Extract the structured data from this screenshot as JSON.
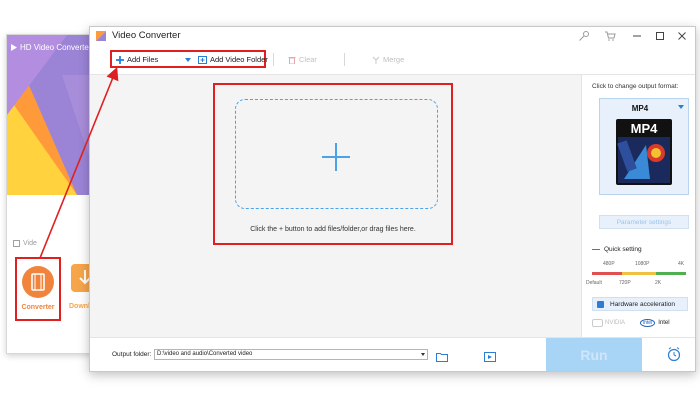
{
  "launcher": {
    "title": "HD Video Converter F",
    "section_label": "Vide",
    "tiles": [
      {
        "label": "Converter",
        "icon": "film-icon"
      },
      {
        "label": "Downlo",
        "icon": "download-icon"
      }
    ]
  },
  "window": {
    "title": "Video Converter",
    "titlebar_icons": [
      "key-icon",
      "cart-icon",
      "minimize-icon",
      "maximize-icon",
      "close-icon"
    ]
  },
  "toolbar": {
    "add_files": "Add Files",
    "add_video_folder": "Add Video Folder",
    "clear": "Clear",
    "merge": "Merge"
  },
  "drop_area": {
    "hint": "Click the + button to add files/folder,or drag files here."
  },
  "sidebar": {
    "change_format_label": "Click to change output format:",
    "format": "MP4",
    "thumb_text": "MP4",
    "parameter_settings": "Parameter settings",
    "quick_setting": "Quick setting",
    "scale_top": [
      "480P",
      "1080P",
      "4K"
    ],
    "scale_bottom": [
      "Default",
      "720P",
      "2K"
    ],
    "hardware_acceleration": "Hardware acceleration",
    "nvidia": "NVIDIA",
    "intel": "Intel",
    "intel_logo": "intel"
  },
  "bottom": {
    "output_folder_label": "Output folder:",
    "output_path": "D:\\video and audio\\Converted video",
    "run": "Run"
  },
  "colors": {
    "accent": "#2a7fd4",
    "highlight": "#e02020",
    "converter_orange": "#f0843c"
  }
}
